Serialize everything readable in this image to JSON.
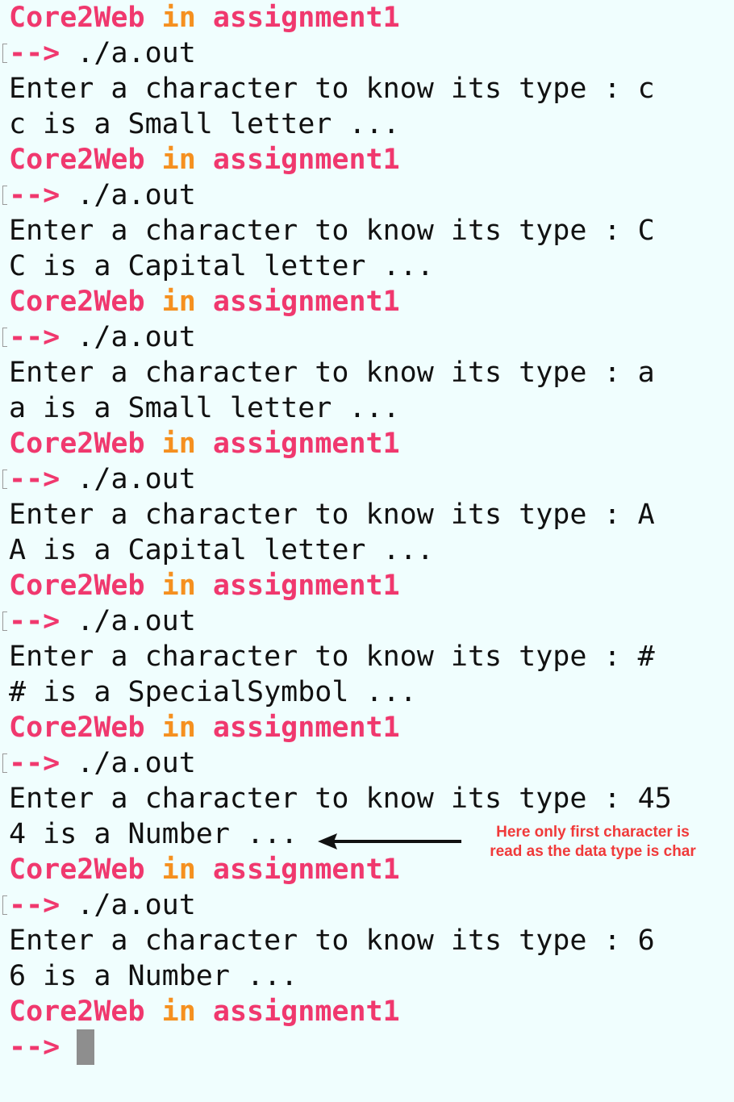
{
  "prompt": {
    "user": "Core2Web",
    "in_word": "in",
    "dir": "assignment1",
    "arrow": "-->",
    "command": "./a.out"
  },
  "runs": [
    {
      "input_prompt": "Enter a character to know its type : c",
      "result": "c is a Small letter ..."
    },
    {
      "input_prompt": "Enter a character to know its type : C",
      "result": "C is a Capital letter ..."
    },
    {
      "input_prompt": "Enter a character to know its type : a",
      "result": "a is a Small letter ..."
    },
    {
      "input_prompt": "Enter a character to know its type : A",
      "result": "A is a Capital letter ..."
    },
    {
      "input_prompt": "Enter a character to know its type : #",
      "result": "# is a SpecialSymbol ..."
    },
    {
      "input_prompt": "Enter a character to know its type : 45",
      "result": "4 is a Number ..."
    },
    {
      "input_prompt": "Enter a character to know its type : 6",
      "result": "6 is a Number ..."
    }
  ],
  "annotation": {
    "line1": "Here only first character is",
    "line2": "read as the data type is char",
    "color": "#f03a3a"
  },
  "colors": {
    "background": "#f0fefe",
    "prompt_pink": "#f0386e",
    "prompt_orange": "#f5901f",
    "text": "#111111"
  }
}
